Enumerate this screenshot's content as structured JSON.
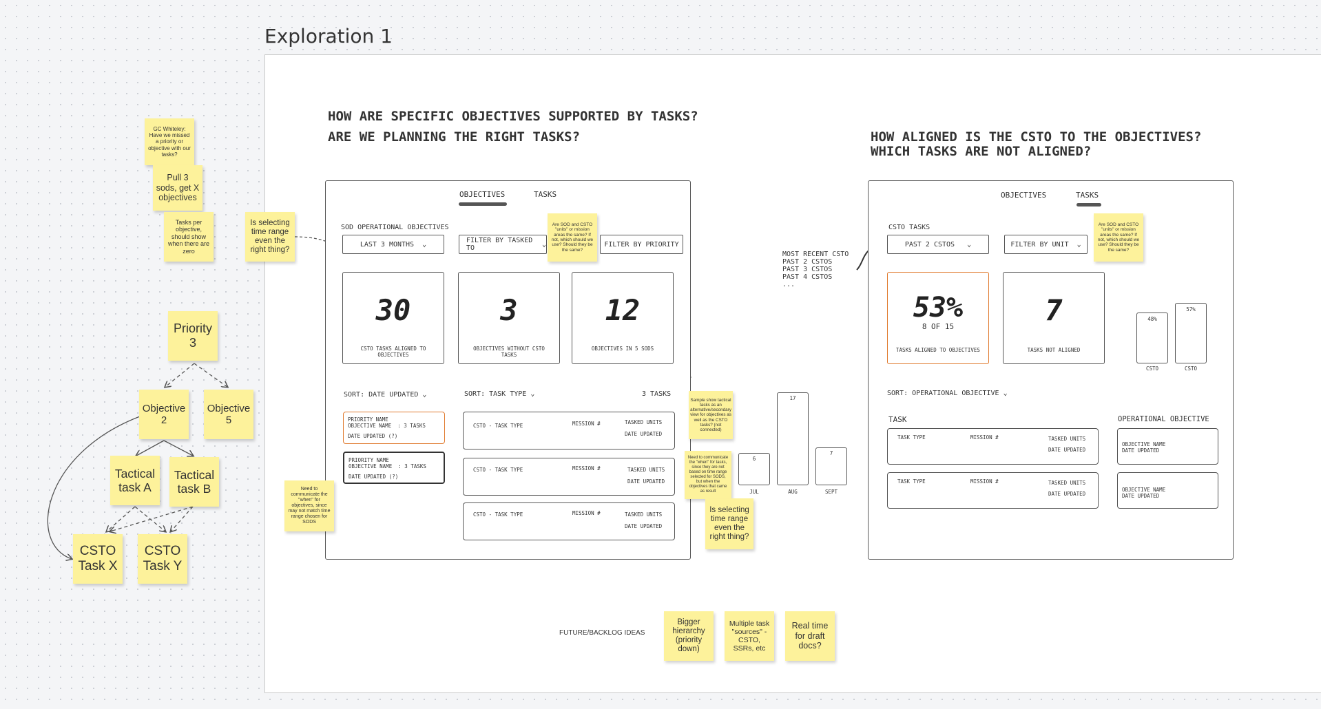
{
  "frame": {
    "title": "Exploration 1"
  },
  "left_questions": {
    "q1": "HOW ARE SPECIFIC OBJECTIVES SUPPORTED BY TASKS?",
    "q2": "ARE WE PLANNING THE RIGHT TASKS?"
  },
  "right_questions": {
    "q1": "HOW ALIGNED IS THE CSTO TO THE OBJECTIVES?",
    "q2": "WHICH TASKS ARE NOT ALIGNED?"
  },
  "left_panel": {
    "tabs": [
      "OBJECTIVES",
      "TASKS"
    ],
    "section_label": "SOD OPERATIONAL OBJECTIVES",
    "dropdowns": [
      "LAST 3 MONTHS",
      "FILTER BY TASKED TO",
      "FILTER BY PRIORITY"
    ],
    "kpis": [
      {
        "value": "30",
        "label": "CSTO TASKS ALIGNED TO OBJECTIVES"
      },
      {
        "value": "3",
        "label": "OBJECTIVES WITHOUT CSTO TASKS"
      },
      {
        "value": "12",
        "label": "OBJECTIVES IN 5 SODS"
      }
    ],
    "sort_left": "SORT: DATE UPDATED",
    "objective_cards": [
      {
        "priority": "PRIORITY NAME",
        "name": "OBJECTIVE NAME",
        "tasks": ": 3 TASKS",
        "date": "DATE UPDATED (?)"
      },
      {
        "priority": "PRIORITY NAME",
        "name": "OBJECTIVE NAME",
        "tasks": ": 3 TASKS",
        "date": "DATE UPDATED (?)"
      }
    ],
    "sort_right": "SORT: TASK TYPE",
    "task_count": "3 TASKS",
    "task_rows": [
      {
        "type": "CSTO - TASK TYPE",
        "mission": "MISSION #",
        "units": "TASKED UNITS",
        "date": "DATE UPDATED"
      },
      {
        "type": "CSTO - TASK TYPE",
        "mission": "MISSION #",
        "units": "TASKED UNITS",
        "date": "DATE UPDATED"
      },
      {
        "type": "CSTO - TASK TYPE",
        "mission": "MISSION #",
        "units": "TASKED UNITS",
        "date": "DATE UPDATED"
      }
    ]
  },
  "month_bars": {
    "bars": [
      {
        "label": "JUL",
        "value": "6",
        "frac": 0.35
      },
      {
        "label": "AUG",
        "value": "17",
        "frac": 1.0
      },
      {
        "label": "SEPT",
        "value": "7",
        "frac": 0.41
      }
    ]
  },
  "right_panel": {
    "tabs": [
      "OBJECTIVES",
      "TASKS"
    ],
    "section_label": "CSTO TASKS",
    "dropdowns": [
      "PAST 2 CSTOS",
      "FILTER BY UNIT"
    ],
    "range_options": [
      "MOST RECENT CSTO",
      "PAST 2 CSTOS",
      "PAST 3 CSTOS",
      "PAST 4 CSTOS",
      "..."
    ],
    "kpi_percent": {
      "value": "53%",
      "sub": "8 OF 15",
      "label": "TASKS ALIGNED TO OBJECTIVES"
    },
    "kpi_count": {
      "value": "7",
      "label": "TASKS NOT ALIGNED"
    },
    "mini_bars": [
      {
        "value": "48%",
        "label": "CSTO",
        "frac": 0.84
      },
      {
        "value": "57%",
        "label": "CSTO",
        "frac": 1.0
      }
    ],
    "sort": "SORT: OPERATIONAL OBJECTIVE",
    "col_task": "TASK",
    "col_objective": "OPERATIONAL OBJECTIVE",
    "task_rows": [
      {
        "type": "TASK TYPE",
        "mission": "MISSION #",
        "units": "TASKED UNITS",
        "date": "DATE UPDATED"
      },
      {
        "type": "TASK TYPE",
        "mission": "MISSION #",
        "units": "TASKED UNITS",
        "date": "DATE UPDATED"
      }
    ],
    "objective_cards": [
      {
        "name": "OBJECTIVE NAME",
        "date": "DATE UPDATED"
      },
      {
        "name": "OBJECTIVE NAME",
        "date": "DATE UPDATED"
      }
    ]
  },
  "stickies": {
    "gc_whiteley": "GC Whiteley: Have we missed a priority or objective with our tasks?",
    "pull_sods": "Pull 3 sods, get X objectives",
    "tasks_per_objective": "Tasks per objective, should show when there are zero",
    "time_range_left": "Is selecting time range even the right thing?",
    "units_left": "Are SOD and CSTO \"units\" or mission areas the same? If not, which should we use? Should they be the same?",
    "units_right": "Are SOD and CSTO \"units\" or mission areas the same? If not, which should we use? Should they be the same?",
    "need_when_left": "Need to communicate the \"when\" for objectives, since may not match time range chosen for SODS",
    "sample_tactical": "Sample show tactical tasks as an alternative/secondary view for objectives as well as the CSTO tasks? (not connected)",
    "need_when_tasks": "Need to communicate the \"when\" for tasks, since they are not based on time range selected for SODS, but when the objectives that came as result",
    "time_range_mid": "Is selecting time range even the right thing?",
    "bigger_hierarchy": "Bigger hierarchy (priority down)",
    "multiple_sources": "Multiple task \"sources\" - CSTO, SSRs, etc",
    "real_time": "Real time for draft docs?"
  },
  "future_label": "FUTURE/BACKLOG IDEAS",
  "hierarchy": {
    "priority": "Priority 3",
    "objective2": "Objective 2",
    "objective5": "Objective 5",
    "tactical_a": "Tactical task A",
    "tactical_b": "Tactical task B",
    "csto_x": "CSTO Task X",
    "csto_y": "CSTO Task Y"
  }
}
